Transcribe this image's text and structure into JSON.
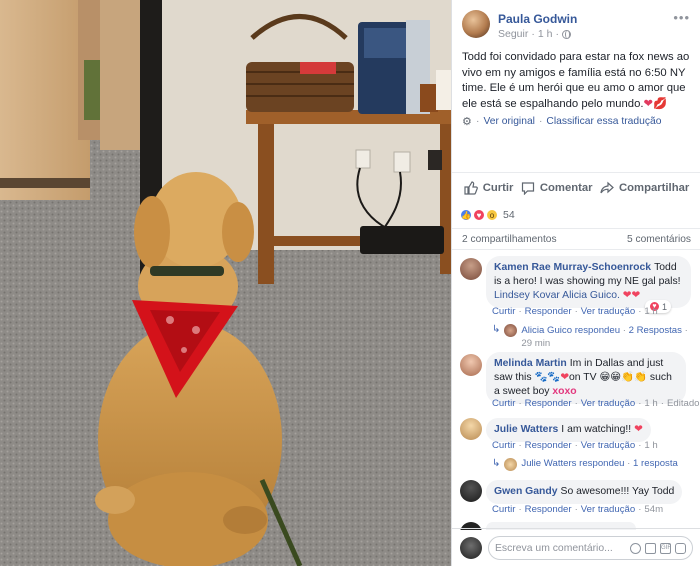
{
  "post": {
    "author": "Paula Godwin",
    "follow_label": "Seguir",
    "separator": "·",
    "time": "1 h",
    "text": "Todd foi convidado para estar na fox news ao vivo em ny amigos e família está no 6:50 NY time. Ele é um herói que eu amo o amor que ele está se espalhando pelo mundo.",
    "text_emoji_heart": "❤",
    "text_emoji_lips": "💋",
    "see_original": "Ver original",
    "rate_translation": "Classificar essa tradução",
    "more_icon": "•••"
  },
  "actions": {
    "like": "Curtir",
    "comment": "Comentar",
    "share": "Compartilhar"
  },
  "reactions": {
    "count": "54",
    "types": [
      "like-icon",
      "love-icon",
      "wow-icon"
    ]
  },
  "counts": {
    "shares": "2 compartilhamentos",
    "comments": "5 comentários"
  },
  "comments": [
    {
      "name": "Kamen Rae Murray-Schoenrock",
      "text": "Todd is a hero! I was showing my NE gal pals!",
      "tags": "Lindsey Kovar Alicia Guico.",
      "emoji": "❤❤",
      "actions": [
        "Curtir",
        "Responder",
        "Ver tradução",
        "1 h"
      ],
      "reaction_count": "1",
      "reply_name": "Alicia Guico",
      "reply_text": "respondeu",
      "reply_dot": "·",
      "reply_count": "2 Respostas",
      "reply_time": "29 min"
    },
    {
      "name": "Melinda Martin",
      "text": "Im in Dallas and just saw this",
      "text2": "on TV",
      "text3": "such a sweet boy",
      "emoji_paws": "🐾🐾❤",
      "emoji_faces": "😁😁👏👏",
      "xoxo": "xoxo",
      "actions": [
        "Curtir",
        "Responder",
        "Ver tradução",
        "1 h",
        "Editado"
      ]
    },
    {
      "name": "Julie Watters",
      "text": "I am watching!!",
      "emoji": "❤",
      "actions": [
        "Curtir",
        "Responder",
        "Ver tradução",
        "1 h"
      ],
      "reply_name": "Julie Watters",
      "reply_text": "respondeu",
      "reply_dot": "·",
      "reply_count": "1 resposta"
    },
    {
      "name": "Gwen Gandy",
      "text": "So awesome!!! Yay Todd",
      "actions": [
        "Curtir",
        "Responder",
        "Ver tradução",
        "54m"
      ]
    }
  ],
  "composer": {
    "placeholder": "Escreva um comentário..."
  },
  "colors": {
    "link": "#365899",
    "meta": "#90949c",
    "bubble": "#f2f3f5",
    "heart": "#f0435f",
    "bandana": "#d4121a",
    "fur": "#c8944a"
  }
}
